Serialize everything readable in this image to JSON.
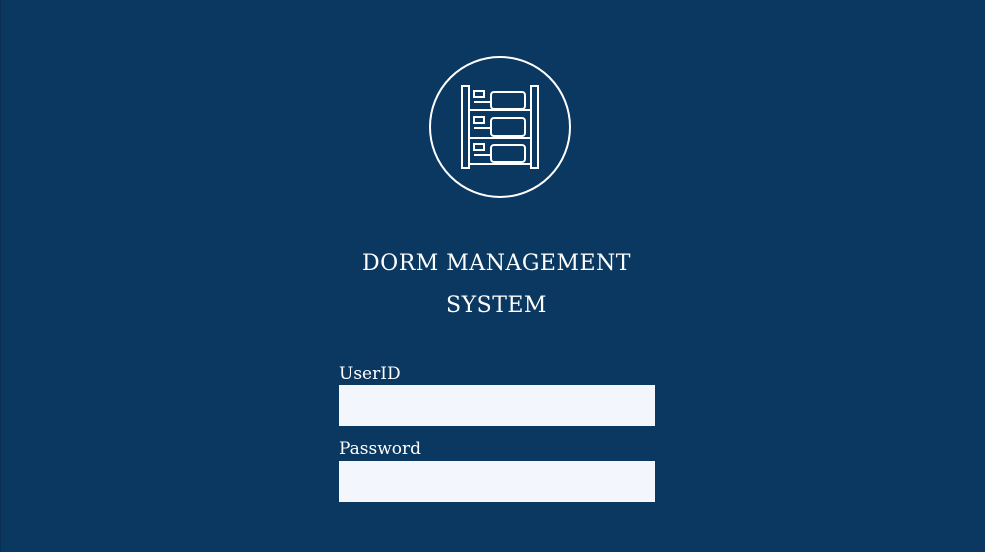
{
  "app": {
    "title_line_1": "DORM MANAGEMENT",
    "title_line_2": "SYSTEM",
    "logo_icon": "server-rack-icon"
  },
  "login_form": {
    "userid_label": "UserID",
    "userid_value": "",
    "password_label": "Password",
    "password_value": ""
  },
  "colors": {
    "background": "#0b3861",
    "input_background": "#f4f6fe",
    "text": "#ffffff"
  }
}
